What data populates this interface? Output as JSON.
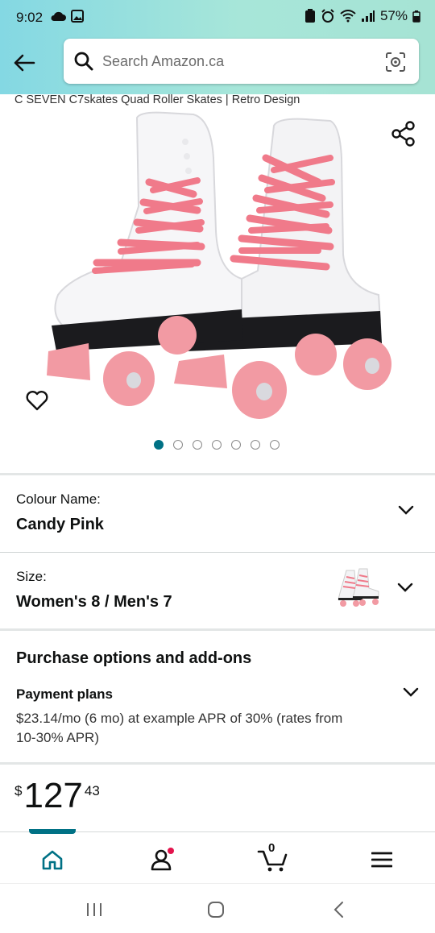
{
  "status_bar": {
    "time": "9:02",
    "battery": "57%"
  },
  "search": {
    "placeholder": "Search Amazon.ca"
  },
  "product": {
    "title": "C SEVEN C7skates Quad Roller Skates | Retro Design",
    "image_count": 7,
    "active_image": 1
  },
  "colour": {
    "label": "Colour Name:",
    "value": "Candy Pink"
  },
  "size": {
    "label": "Size:",
    "value": "Women's 8 / Men's 7"
  },
  "purchase": {
    "title": "Purchase options and add-ons",
    "payment_title": "Payment plans",
    "payment_text": "$23.14/mo (6 mo) at example APR of 30% (rates from 10-30% APR)"
  },
  "price": {
    "currency": "$",
    "whole": "127",
    "fraction": "43"
  },
  "nav": {
    "cart_count": "0",
    "items": [
      "home-icon",
      "account-icon",
      "cart-icon",
      "menu-icon"
    ]
  },
  "colors": {
    "accent": "#007185",
    "notification": "#e3134c",
    "header_start": "#84d8e3",
    "header_end": "#a6e3d4",
    "skate_pink": "#f29aa3",
    "lace_pink": "#f07a8a"
  }
}
